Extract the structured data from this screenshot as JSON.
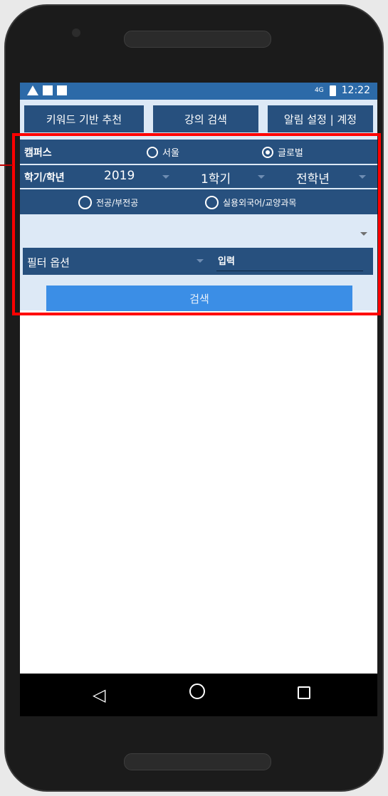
{
  "statusbar": {
    "signal": "4G",
    "time": "12:22"
  },
  "tabs": [
    {
      "label": "키워드 기반 추천"
    },
    {
      "label": "강의 검색"
    },
    {
      "label": "알림 설정 | 계정"
    }
  ],
  "campus": {
    "label": "캠퍼스",
    "options": [
      {
        "label": "서울",
        "selected": false
      },
      {
        "label": "글로벌",
        "selected": true
      }
    ]
  },
  "semester": {
    "label": "학기/학년",
    "year": "2019",
    "term": "1학기",
    "grade": "전학년"
  },
  "course_type": {
    "options": [
      {
        "label": "전공/부전공",
        "selected": false
      },
      {
        "label": "실용외국어/교양과목",
        "selected": false
      }
    ]
  },
  "filter": {
    "label": "필터 옵션",
    "input_placeholder": "입력"
  },
  "search_button": "검색",
  "colors": {
    "primary": "#27507e",
    "status": "#2c6aa8",
    "button": "#3b8ee6",
    "highlight": "#ff0000"
  }
}
